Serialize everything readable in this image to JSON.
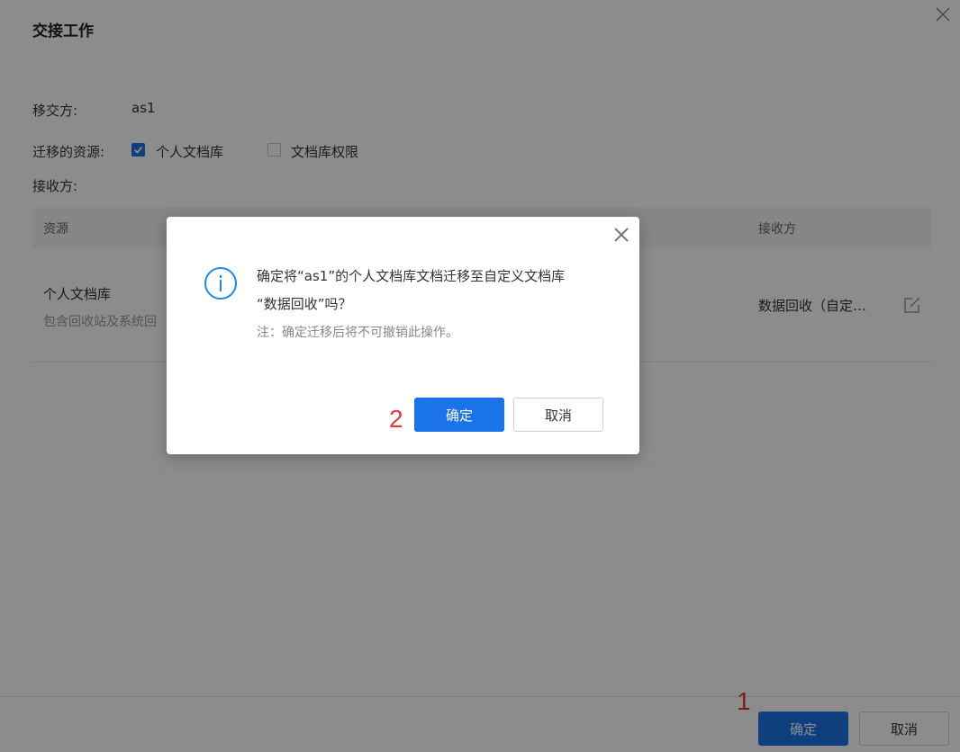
{
  "page": {
    "title": "交接工作",
    "transferor_label": "移交方:",
    "transferor_value": "as1",
    "resources_label": "迁移的资源:",
    "resources": [
      {
        "label": "个人文档库",
        "checked": true
      },
      {
        "label": "文档库权限",
        "checked": false
      }
    ],
    "receiver_label": "接收方:",
    "table": {
      "columns": [
        "资源",
        "接收方"
      ],
      "rows": [
        {
          "resource": "个人文档库",
          "description": "包含回收站及系统回",
          "receiver": "数据回收（自定…"
        }
      ]
    },
    "footer": {
      "confirm_label": "确定",
      "cancel_label": "取消"
    },
    "step_marker": "1"
  },
  "dialog": {
    "message_line1": "确定将“as1”的个人文档库文档迁移至自定义文档库",
    "message_line2": "“数据回收”吗？",
    "note": "注：确定迁移后将不可撤销此操作。",
    "confirm_label": "确定",
    "cancel_label": "取消",
    "step_marker": "2"
  },
  "colors": {
    "primary": "#1a73e8",
    "overlay": "rgba(0,0,0,0.45)",
    "step_marker": "#e53935",
    "info_icon": "#1a8cf0"
  },
  "icons": [
    "close-icon",
    "edit-icon",
    "info-icon",
    "check-icon"
  ]
}
